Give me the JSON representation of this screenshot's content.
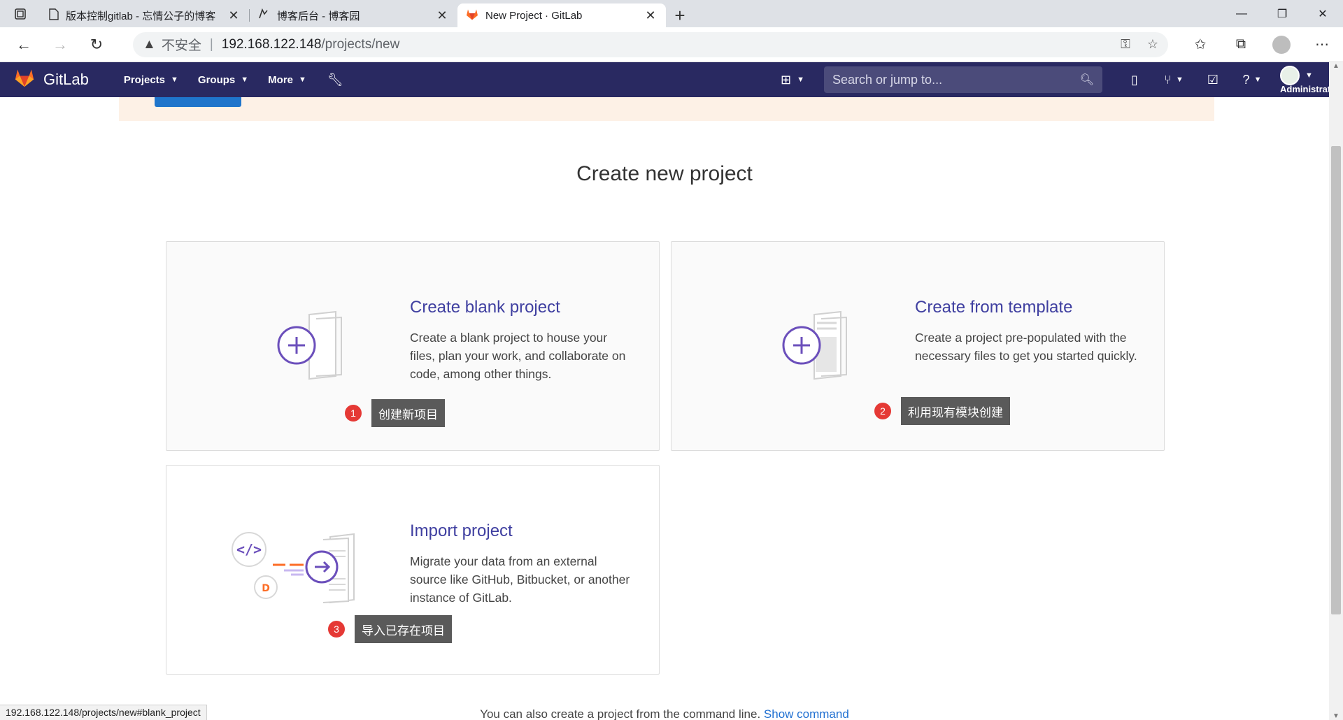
{
  "browser": {
    "tabs": [
      {
        "title": "版本控制gitlab - 忘情公子的博客"
      },
      {
        "title": "博客后台 - 博客园"
      },
      {
        "title": "New Project · GitLab"
      }
    ],
    "address": {
      "insecure_label": "不安全",
      "host": "192.168.122.148",
      "path": "/projects/new"
    },
    "status_url": "192.168.122.148/projects/new#blank_project"
  },
  "gitlab": {
    "brand": "GitLab",
    "nav": {
      "projects": "Projects",
      "groups": "Groups",
      "more": "More"
    },
    "search_placeholder": "Search or jump to...",
    "user": "Administrator"
  },
  "page": {
    "title": "Create new project",
    "cards": {
      "blank": {
        "title": "Create blank project",
        "description": "Create a blank project to house your files, plan your work, and collaborate on code, among other things."
      },
      "template": {
        "title": "Create from template",
        "description": "Create a project pre-populated with the necessary files to get you started quickly."
      },
      "import": {
        "title": "Import project",
        "description": "Migrate your data from an external source like GitHub, Bitbucket, or another instance of GitLab."
      }
    },
    "annotations": [
      {
        "num": "1",
        "text": "创建新项目"
      },
      {
        "num": "2",
        "text": "利用现有模块创建"
      },
      {
        "num": "3",
        "text": "导入已存在项目"
      }
    ],
    "footer": {
      "text": "You can also create a project from the command line.",
      "link": "Show command"
    }
  },
  "colors": {
    "gitlab_header": "#292961",
    "card_title": "#3f3fa0",
    "accent_purple": "#6b4fbb",
    "annotation_red": "#e53935",
    "link_blue": "#1f6fd1"
  }
}
